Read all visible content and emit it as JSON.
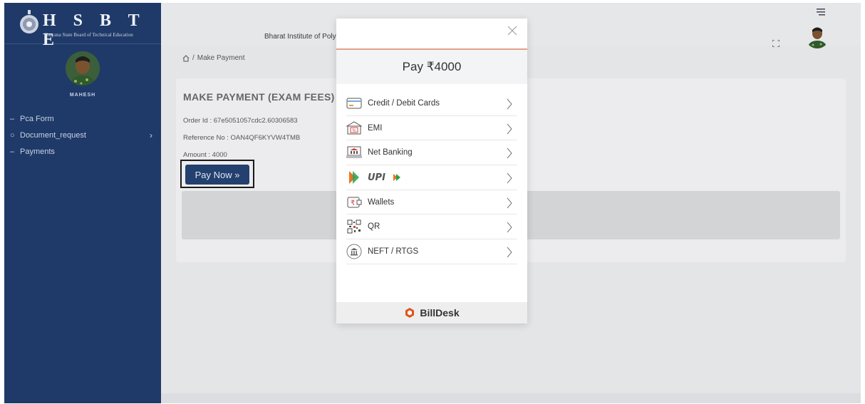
{
  "sidebar": {
    "logo_text": "H S B T E",
    "logo_subtitle": "Haryana State Board of Technical Education",
    "user_name": "MAHESH",
    "items": [
      {
        "marker": "–",
        "label": "Pca Form",
        "has_chevron": false
      },
      {
        "marker": "○",
        "label": "Document_request",
        "has_chevron": true
      },
      {
        "marker": "–",
        "label": "Payments",
        "has_chevron": false
      }
    ],
    "chevron": "›"
  },
  "topbar": {
    "institute_name": "Bharat Institute of Polyte"
  },
  "breadcrumb": {
    "separator": "/",
    "current": "Make Payment"
  },
  "payment_card": {
    "title": "MAKE PAYMENT (EXAM FEES)",
    "order_id": "Order Id : 67e5051057cdc2.60306583",
    "reference_no": "Reference No : OAN4QF6KYVW4TMB",
    "amount": "Amount : 4000",
    "pay_button_label": "Pay Now »"
  },
  "modal": {
    "header": "Pay ₹4000",
    "options": [
      {
        "label": "Credit / Debit Cards",
        "icon": "card-icon"
      },
      {
        "label": "EMI",
        "icon": "emi-icon"
      },
      {
        "label": "Net Banking",
        "icon": "bank-icon"
      },
      {
        "label": "",
        "icon": "upi-logo"
      },
      {
        "label": "Wallets",
        "icon": "wallet-icon"
      },
      {
        "label": "QR",
        "icon": "qr-icon"
      },
      {
        "label": "NEFT / RTGS",
        "icon": "neft-icon"
      }
    ],
    "footer_brand": "BillDesk"
  },
  "colors": {
    "sidebar_bg": "#1f3a68",
    "pay_button_bg": "#23406f",
    "billdesk_orange": "#e0551b",
    "modal_accent": "#e2a08c"
  }
}
